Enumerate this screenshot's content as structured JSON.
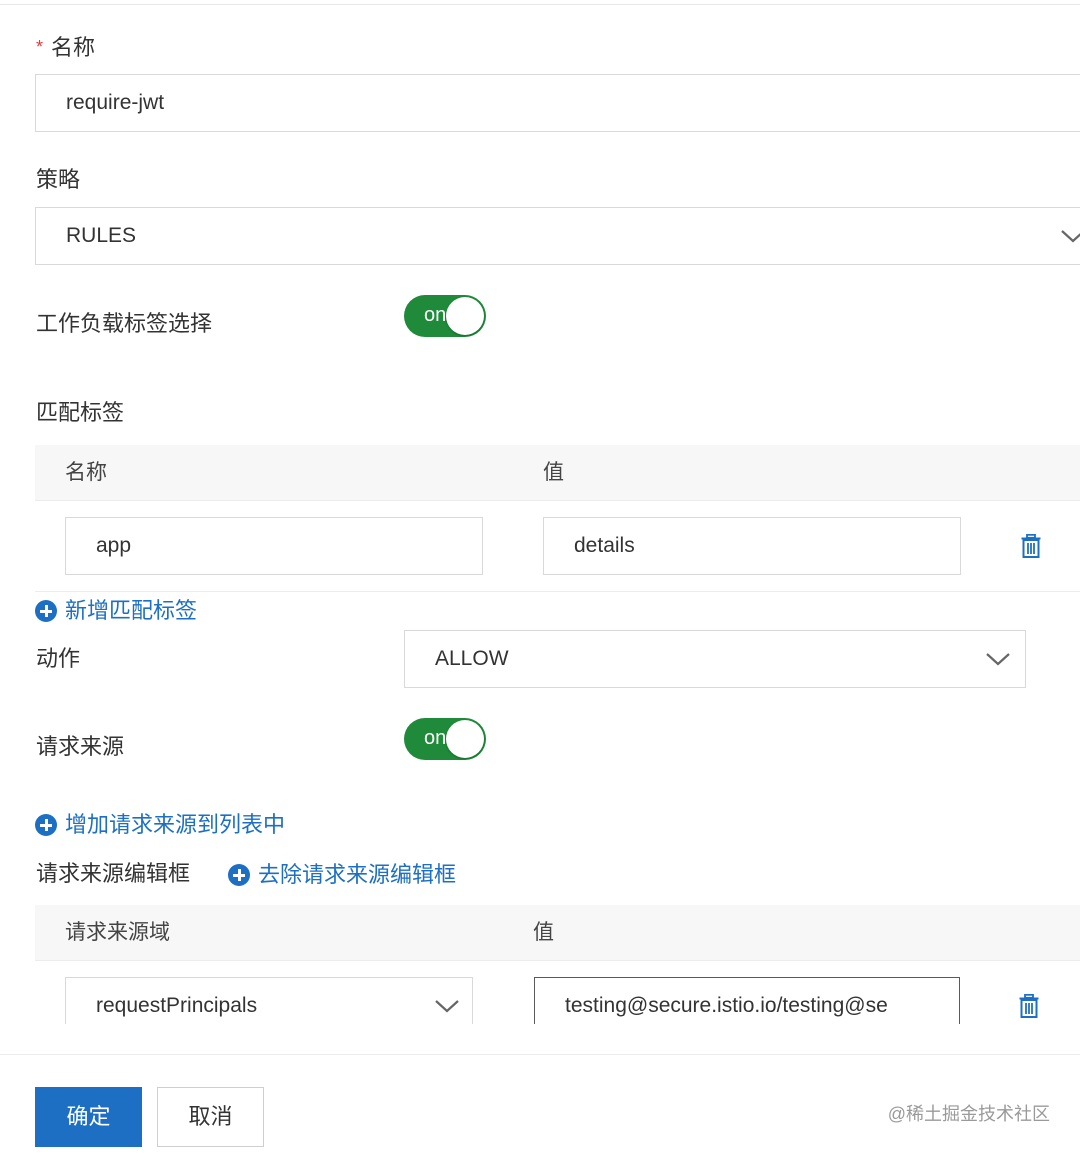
{
  "form": {
    "name": {
      "required_mark": "*",
      "label": "名称",
      "value": "require-jwt"
    },
    "policy": {
      "label": "策略",
      "value": "RULES"
    },
    "workload_selector": {
      "label": "工作负载标签选择",
      "toggle_text": "on"
    },
    "match_labels": {
      "label": "匹配标签",
      "columns": [
        "名称",
        "值"
      ],
      "rows": [
        {
          "name": "app",
          "value": "details"
        }
      ],
      "add_link": "新增匹配标签"
    },
    "action": {
      "label": "动作",
      "value": "ALLOW"
    },
    "request_source": {
      "label": "请求来源",
      "toggle_text": "on"
    },
    "add_source_link": "增加请求来源到列表中",
    "source_editor": {
      "label": "请求来源编辑框",
      "remove_link": "去除请求来源编辑框",
      "columns": [
        "请求来源域",
        "值"
      ],
      "rows": [
        {
          "domain": "requestPrincipals",
          "value": "testing@secure.istio.io/testing@se"
        }
      ]
    }
  },
  "footer": {
    "confirm_label": "确定",
    "cancel_label": "取消"
  },
  "watermark": "@稀土掘金技术社区",
  "colors": {
    "primary": "#1d6fc4",
    "toggle_on": "#1f8b3a",
    "required": "#e4393c"
  },
  "icons": [
    "plus-circle-icon",
    "trash-icon",
    "chevron-down-icon"
  ]
}
